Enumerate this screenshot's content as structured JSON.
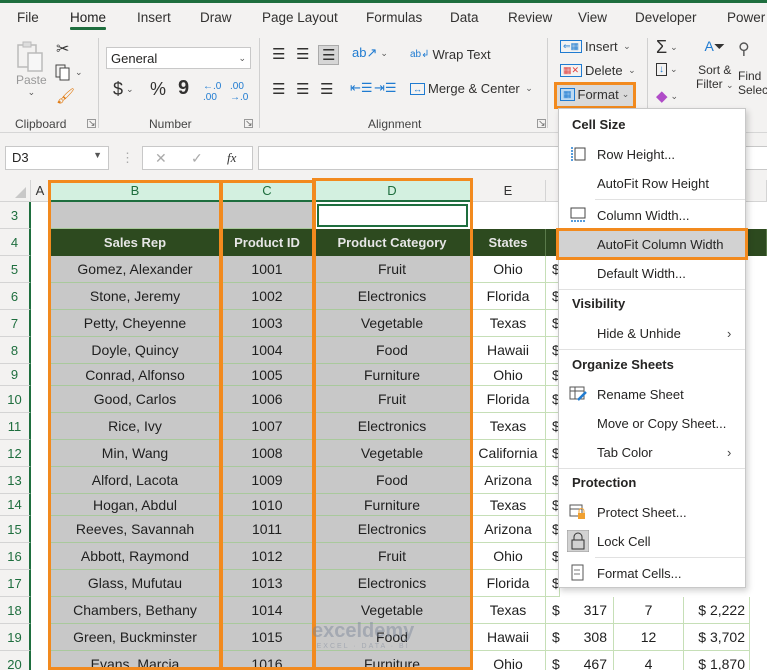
{
  "tabs": [
    {
      "label": "File",
      "active": false
    },
    {
      "label": "Home",
      "active": true
    },
    {
      "label": "Insert",
      "active": false
    },
    {
      "label": "Draw",
      "active": false
    },
    {
      "label": "Page Layout",
      "active": false
    },
    {
      "label": "Formulas",
      "active": false
    },
    {
      "label": "Data",
      "active": false
    },
    {
      "label": "Review",
      "active": false
    },
    {
      "label": "View",
      "active": false
    },
    {
      "label": "Developer",
      "active": false
    },
    {
      "label": "Power",
      "active": false
    }
  ],
  "ribbon": {
    "clipboard": {
      "label": "Clipboard",
      "paste": "Paste"
    },
    "number": {
      "label": "Number",
      "format_value": "General",
      "currency": "$",
      "percent": "%",
      "comma": "9"
    },
    "alignment": {
      "label": "Alignment",
      "wrap_text": "Wrap Text",
      "merge_center": "Merge & Center"
    },
    "cells": {
      "insert": "Insert",
      "delete": "Delete",
      "format": "Format"
    },
    "editing": {
      "sort_filter_1": "Sort &",
      "sort_filter_2": "Filter",
      "find_1": "Find",
      "find_2": "Select"
    }
  },
  "formula_bar": {
    "name_box": "D3",
    "cancel": "✕",
    "enter": "✓",
    "fx": "fx",
    "formula": ""
  },
  "columns": [
    "A",
    "B",
    "C",
    "D",
    "E"
  ],
  "row_numbers": [
    "3",
    "4",
    "5",
    "6",
    "7",
    "8",
    "9",
    "10",
    "11",
    "12",
    "13",
    "14",
    "15",
    "16",
    "17",
    "18",
    "19",
    "20"
  ],
  "table": {
    "headers": [
      "Sales Rep",
      "Product ID",
      "Product Category",
      "States"
    ],
    "rows": [
      [
        "Gomez, Alexander",
        "1001",
        "Fruit",
        "Ohio"
      ],
      [
        "Stone, Jeremy",
        "1002",
        "Electronics",
        "Florida"
      ],
      [
        "Petty, Cheyenne",
        "1003",
        "Vegetable",
        "Texas"
      ],
      [
        "Doyle, Quincy",
        "1004",
        "Food",
        "Hawaii"
      ],
      [
        "Conrad, Alfonso",
        "1005",
        "Furniture",
        "Ohio"
      ],
      [
        "Good, Carlos",
        "1006",
        "Fruit",
        "Florida"
      ],
      [
        "Rice, Ivy",
        "1007",
        "Electronics",
        "Texas"
      ],
      [
        "Min, Wang",
        "1008",
        "Vegetable",
        "California"
      ],
      [
        "Alford, Lacota",
        "1009",
        "Food",
        "Arizona"
      ],
      [
        "Hogan, Abdul",
        "1010",
        "Furniture",
        "Texas"
      ],
      [
        "Reeves, Savannah",
        "1011",
        "Electronics",
        "Arizona"
      ],
      [
        "Abbott, Raymond",
        "1012",
        "Fruit",
        "Ohio"
      ],
      [
        "Glass, Mufutau",
        "1013",
        "Electronics",
        "Florida"
      ],
      [
        "Chambers, Bethany",
        "1014",
        "Vegetable",
        "Texas"
      ],
      [
        "Green, Buckminster",
        "1015",
        "Food",
        "Hawaii"
      ],
      [
        "Evans, Marcia",
        "1016",
        "Furniture",
        "Ohio"
      ]
    ],
    "extra_rows": [
      {
        "price_symbol": "$",
        "price": "317",
        "qty": "7",
        "total": "$ 2,222"
      },
      {
        "price_symbol": "$",
        "price": "308",
        "qty": "12",
        "total": "$ 3,702"
      },
      {
        "price_symbol": "$",
        "price": "467",
        "qty": "4",
        "total": "$ 1,870"
      }
    ],
    "partial_symbol": "$"
  },
  "format_menu": {
    "sections": {
      "cell_size": "Cell Size",
      "visibility": "Visibility",
      "organize": "Organize Sheets",
      "protection": "Protection"
    },
    "items": {
      "row_height": "Row Height...",
      "autofit_row": "AutoFit Row Height",
      "column_width": "Column Width...",
      "autofit_column": "AutoFit Column Width",
      "default_width": "Default Width...",
      "hide_unhide": "Hide & Unhide",
      "rename_sheet": "Rename Sheet",
      "move_copy": "Move or Copy Sheet...",
      "tab_color": "Tab Color",
      "protect_sheet": "Protect Sheet...",
      "lock_cell": "Lock Cell",
      "format_cells": "Format Cells..."
    },
    "highlighted": "AutoFit Column Width"
  },
  "watermark": {
    "name": "exceldemy",
    "tagline": "EXCEL · DATA · BI"
  },
  "colors": {
    "excel_green": "#1e6e3e",
    "header_fill": "#2d4a1f",
    "highlight_orange": "#f28a1e",
    "selection_gray": "#c8c8c8"
  }
}
